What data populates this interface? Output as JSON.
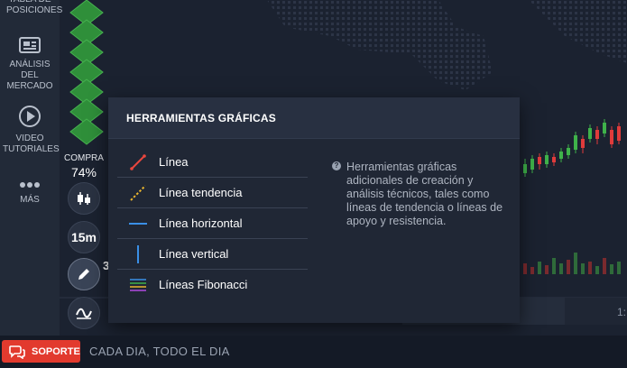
{
  "sidebar": {
    "items": [
      {
        "label": "TABLA DE POSICIONES",
        "icon": "table-icon"
      },
      {
        "label": "ANÁLISIS DEL MERCADO",
        "icon": "newspaper-icon"
      },
      {
        "label": "VIDEO TUTORIALES",
        "icon": "play-icon"
      },
      {
        "label": "MÁS",
        "icon": "more-dots-icon"
      }
    ]
  },
  "trade": {
    "compra_label": "COMPRA",
    "compra_percent": "74%",
    "timeframe": "15m",
    "partial_value": "3",
    "axis_partial": "1:"
  },
  "panel": {
    "title": "HERRAMIENTAS GRÁFICAS",
    "tools": [
      {
        "label": "Línea",
        "icon": "line-icon"
      },
      {
        "label": "Línea tendencia",
        "icon": "trend-line-icon"
      },
      {
        "label": "Línea horizontal",
        "icon": "horizontal-line-icon"
      },
      {
        "label": "Línea vertical",
        "icon": "vertical-line-icon"
      },
      {
        "label": "Líneas Fibonacci",
        "icon": "fibonacci-lines-icon"
      }
    ],
    "description": "Herramientas gráficas adicionales de creación y análisis  técnicos, tales como líneas de tendencia o líneas de apoyo y resistencia."
  },
  "bottom": {
    "support_label": "SOPORTE",
    "ticker": "CADA DIA, TODO EL DIA"
  },
  "colors": {
    "accent_red": "#e23a2e",
    "candle_green": "#3fb24a",
    "candle_red": "#e03b3b",
    "tool_line": "#e8463e",
    "tool_trend": "#e9b52e",
    "tool_horizontal": "#3a8fe6",
    "tool_vertical": "#3a8fe6"
  }
}
